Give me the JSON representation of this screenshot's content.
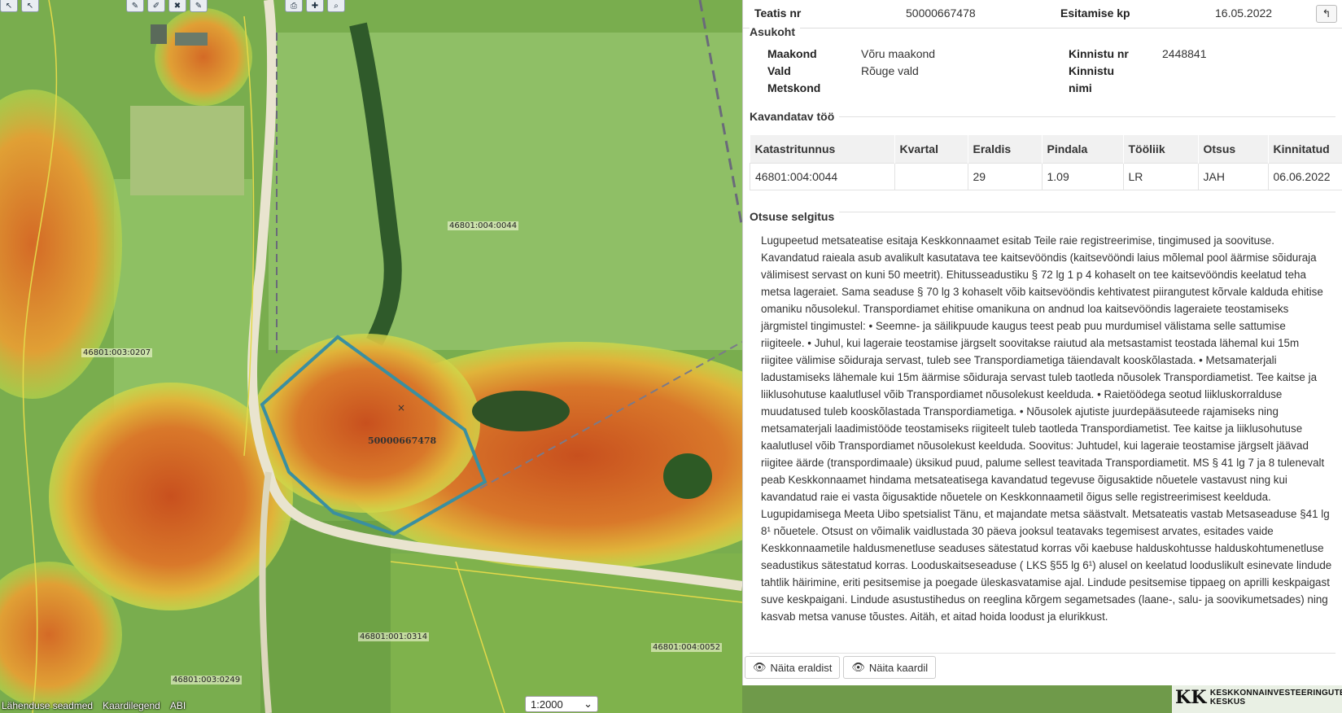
{
  "map": {
    "parcel_labels": [
      "46801:004:0044",
      "46801:003:0207",
      "46801:001:0314",
      "46801:004:0052",
      "46801:003:0249"
    ],
    "notice_label": "50000667478",
    "scale": "1:2000",
    "bottom_links": [
      "Lähenduse seadmed",
      "Kaardilegend",
      "ABI"
    ],
    "logo_text": "KESKKONNAINVESTEERINGUTE KESKUS",
    "outline_color": "#3a8fa0"
  },
  "panel": {
    "header": {
      "notice_label": "Teatis nr",
      "notice_value": "50000667478",
      "date_label": "Esitamise kp",
      "date_value": "16.05.2022"
    },
    "location": {
      "title": "Asukoht",
      "county_label": "Maakond",
      "county_value": "Võru maakond",
      "parish_label": "Vald",
      "parish_value": "Rõuge vald",
      "forest_district_label": "Metskond",
      "property_nr_label": "Kinnistu nr",
      "property_nr_value": "2448841",
      "property_name_label_1": "Kinnistu",
      "property_name_label_2": "nimi"
    },
    "planned_work": {
      "title": "Kavandatav töö",
      "columns": [
        "Katastritunnus",
        "Kvartal",
        "Eraldis",
        "Pindala",
        "Tööliik",
        "Otsus",
        "Kinnitatud"
      ],
      "rows": [
        [
          "46801:004:0044",
          "",
          "29",
          "1.09",
          "LR",
          "JAH",
          "06.06.2022"
        ]
      ]
    },
    "explanation": {
      "title": "Otsuse selgitus",
      "text": "Lugupeetud metsateatise esitaja Keskkonnaamet esitab Teile raie registreerimise, tingimused ja soovituse. Kavandatud raieala asub avalikult kasutatava tee kaitsevööndis (kaitsevööndi laius mõlemal pool äärmise sõiduraja välimisest servast on kuni 50 meetrit). Ehitusseadustiku § 72 lg 1 p 4 kohaselt on tee kaitsevööndis keelatud teha metsa lageraiet. Sama seaduse § 70 lg 3 kohaselt võib kaitsevööndis kehtivatest piirangutest kõrvale kalduda ehitise omaniku nõusolekul. Transpordiamet ehitise omanikuna on andnud loa kaitsevööndis lageraiete teostamiseks järgmistel tingimustel: • Seemne- ja säilikpuude kaugus teest peab puu murdumisel välistama selle sattumise riigiteele. • Juhul, kui lageraie teostamise järgselt soovitakse raiutud ala metsastamist teostada lähemal kui 15m riigitee välimise sõiduraja servast, tuleb see Transpordiametiga täiendavalt kooskõlastada. • Metsamaterjali ladustamiseks lähemale kui 15m äärmise sõiduraja servast tuleb taotleda nõusolek Transpordiametist. Tee kaitse ja liiklusohutuse kaalutlusel võib Transpordiamet nõusolekust keelduda. • Raietöödega seotud liikluskorralduse muudatused tuleb kooskõlastada Transpordiametiga. • Nõusolek ajutiste juurdepääsuteede rajamiseks ning metsamaterjali laadimistööde teostamiseks riigiteelt tuleb taotleda Transpordiametist. Tee kaitse ja liiklusohutuse kaalutlusel võib Transpordiamet nõusolekust keelduda. Soovitus: Juhtudel, kui lageraie teostamise järgselt jäävad riigitee äärde (transpordimaale) üksikud puud, palume sellest teavitada Transpordiametit. MS § 41 lg 7 ja 8 tulenevalt peab Keskkonnaamet hindama metsateatisega kavandatud tegevuse õigusaktide nõuetele vastavust ning kui kavandatud raie ei vasta õigusaktide nõuetele on Keskkonnaametil õigus selle registreerimisest keelduda. Lugupidamisega Meeta Uibo spetsialist Tänu, et majandate metsa säästvalt. Metsateatis vastab Metsaseaduse §41 lg 8¹ nõuetele. Otsust on võimalik vaidlustada 30 päeva jooksul teatavaks tegemisest arvates, esitades vaide Keskkonnaametile haldusmenetluse seaduses sätestatud korras või kaebuse halduskohtusse halduskohtumenetluse seadustikus sätestatud korras. Looduskaitseseaduse ( LKS §55 lg 6¹) alusel on keelatud looduslikult esinevate lindude tahtlik häirimine, eriti pesitsemise ja poegade üleskasvatamise ajal. Lindude pesitsemise tippaeg on aprilli keskpaigast suve keskpaigani. Lindude asustustihedus on reeglina kõrgem segametsades (laane-, salu- ja soovikumetsades) ning kasvab metsa vanuse tõustes. Aitäh, et aitad hoida loodust ja elurikkust."
    },
    "buttons": {
      "show_stand": "Näita eraldist",
      "show_map": "Näita kaardil"
    }
  }
}
